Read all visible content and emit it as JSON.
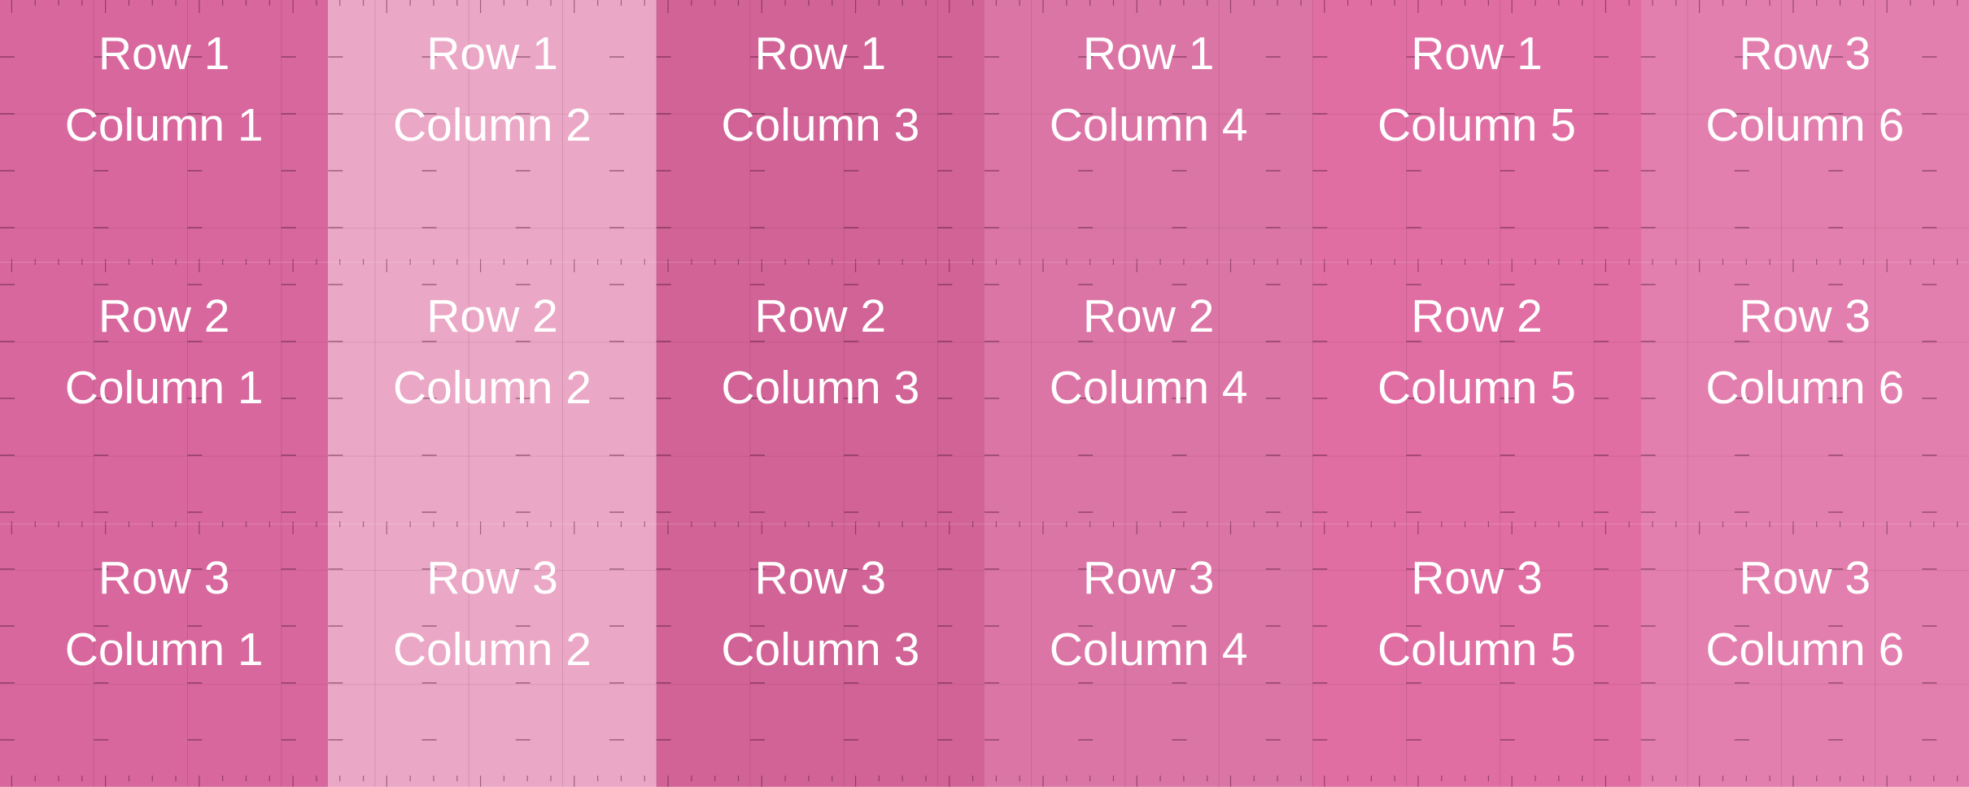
{
  "columns": [
    {
      "color": "#d8679d"
    },
    {
      "color": "#eba8c6"
    },
    {
      "color": "#d26396"
    },
    {
      "color": "#db75a5"
    },
    {
      "color": "#e06ea3"
    },
    {
      "color": "#e37fae"
    }
  ],
  "cells": [
    [
      {
        "row": "Row 1",
        "col": "Column 1"
      },
      {
        "row": "Row 1",
        "col": "Column 2"
      },
      {
        "row": "Row 1",
        "col": "Column 3"
      },
      {
        "row": "Row 1",
        "col": "Column 4"
      },
      {
        "row": "Row 1",
        "col": "Column 5"
      },
      {
        "row": "Row 3",
        "col": "Column 6"
      }
    ],
    [
      {
        "row": "Row 2",
        "col": "Column 1"
      },
      {
        "row": "Row 2",
        "col": "Column 2"
      },
      {
        "row": "Row 2",
        "col": "Column 3"
      },
      {
        "row": "Row 2",
        "col": "Column 4"
      },
      {
        "row": "Row 2",
        "col": "Column 5"
      },
      {
        "row": "Row 3",
        "col": "Column 6"
      }
    ],
    [
      {
        "row": "Row 3",
        "col": "Column 1"
      },
      {
        "row": "Row 3",
        "col": "Column 2"
      },
      {
        "row": "Row 3",
        "col": "Column 3"
      },
      {
        "row": "Row 3",
        "col": "Column 4"
      },
      {
        "row": "Row 3",
        "col": "Column 5"
      },
      {
        "row": "Row 3",
        "col": "Column 6"
      }
    ]
  ]
}
